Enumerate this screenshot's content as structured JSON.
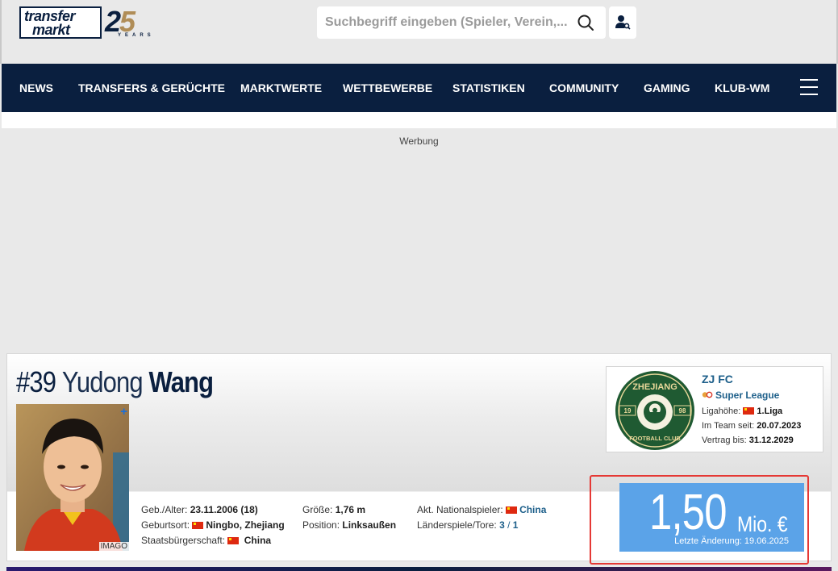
{
  "header": {
    "logo": {
      "word1": "transfer",
      "word2": "markt",
      "anniversary": "25",
      "years": "YEARS"
    },
    "search": {
      "placeholder": "Suchbegriff eingeben (Spieler, Verein,...)"
    }
  },
  "nav": {
    "items": [
      "NEWS",
      "TRANSFERS & GERÜCHTE",
      "MARKTWERTE",
      "WETTBEWERBE",
      "STATISTIKEN",
      "COMMUNITY",
      "GAMING",
      "KLUB-WM"
    ]
  },
  "ad": {
    "label": "Werbung"
  },
  "player": {
    "number": "#39",
    "first_name": "Yudong",
    "last_name": "Wang",
    "photo_credit": "IMAGO",
    "photo_plus": "+",
    "birth_label": "Geb./Alter:",
    "birth_value": "23.11.2006 (18)",
    "birthplace_label": "Geburtsort:",
    "birthplace_value": "Ningbo, Zhejiang",
    "citizenship_label": "Staatsbürgerschaft:",
    "citizenship_value": "China",
    "height_label": "Größe:",
    "height_value": "1,76 m",
    "position_label": "Position:",
    "position_value": "Linksaußen",
    "national_label": "Akt. Nationalspieler:",
    "national_value": "China",
    "caps_label": "Länderspiele/Tore:",
    "caps_value": "3",
    "caps_sep": "/",
    "goals_value": "1"
  },
  "club": {
    "name": "ZJ FC",
    "league": "Super League",
    "level_label": "Ligahöhe:",
    "level_value": "1.Liga",
    "since_label": "Im Team seit:",
    "since_value": "20.07.2023",
    "contract_label": "Vertrag bis:",
    "contract_value": "31.12.2029",
    "logo_text_top": "ZHEJIANG",
    "logo_text_bottom": "FOOTBALL CLUB",
    "logo_left": "19",
    "logo_right": "98"
  },
  "market_value": {
    "value": "1,50",
    "unit": "Mio. €",
    "updated": "Letzte Änderung: 19.06.2025"
  },
  "colors": {
    "navy": "#0a1f3f",
    "market_value_bg": "#5ba3e8",
    "link": "#1d5f8a",
    "highlight": "#e53935",
    "club_green": "#1f5a32"
  },
  "icons": [
    "search-icon",
    "user-search-icon",
    "hamburger-menu-icon",
    "china-flag-icon",
    "csl-league-icon"
  ]
}
